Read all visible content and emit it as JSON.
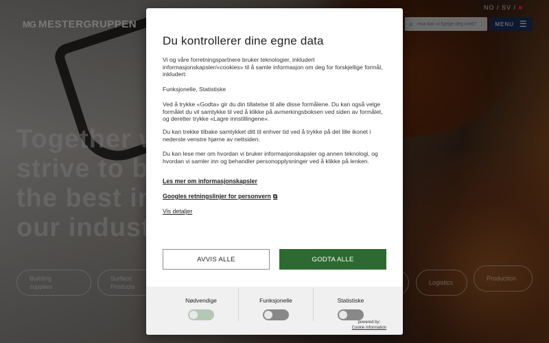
{
  "header": {
    "logo_mark": "MG",
    "logo_text": "MESTERGRUPPEN",
    "languages": "NO / SV /",
    "search_placeholder": "Hva kan vi hjelpe deg med?",
    "menu_label": "MENU"
  },
  "hero": {
    "tagline_lines": [
      "Together w",
      "strive to b",
      "the best in",
      "our indust"
    ],
    "pills": [
      "Building supplies",
      "Surface Products",
      "Logistics",
      "Production"
    ]
  },
  "consent": {
    "title": "Du kontrollerer dine egne data",
    "intro": "Vi og våre forretningspartnere bruker teknologier, inkludert informasjonskapsler/«cookies» til å samle informasjon om deg for forskjellige formål, inkludert:",
    "purposes": "Funksjonelle, Statistiske",
    "paragraph_accept": "Ved å trykke «Godta» gir du din tillatelse til alle disse formålene. Du kan også velge formålet du vil samtykke til ved å klikke på avmerkingsboksen ved siden av formålet, og deretter trykke «Lagre innstillingene».",
    "paragraph_withdraw": "Du kan trekke tilbake samtykket ditt til enhver tid ved å trykke på det lille ikonet i nederste venstre hjørne av nettsiden.",
    "paragraph_more": "Du kan lese mer om hvordan vi bruker informasjonskapsler og annen teknologi, og hvordan vi samler inn og behandler personopplysninger ved å klikke på lenken.",
    "link_cookies": "Les mer om informasjonskapsler",
    "link_google": "Googles retningslinjer for personvern",
    "link_details": "Vis detaljer",
    "reject_label": "AVVIS ALLE",
    "accept_label": "GODTA ALLE",
    "toggles": [
      {
        "label": "Nødvendige",
        "on": true
      },
      {
        "label": "Funksjonelle",
        "on": false
      },
      {
        "label": "Statistiske",
        "on": false
      }
    ],
    "powered_by": "powered by:",
    "powered_brand": "Cookie Information"
  },
  "colors": {
    "accept_green": "#2d6a31",
    "menu_navy": "#1c2e5a"
  }
}
